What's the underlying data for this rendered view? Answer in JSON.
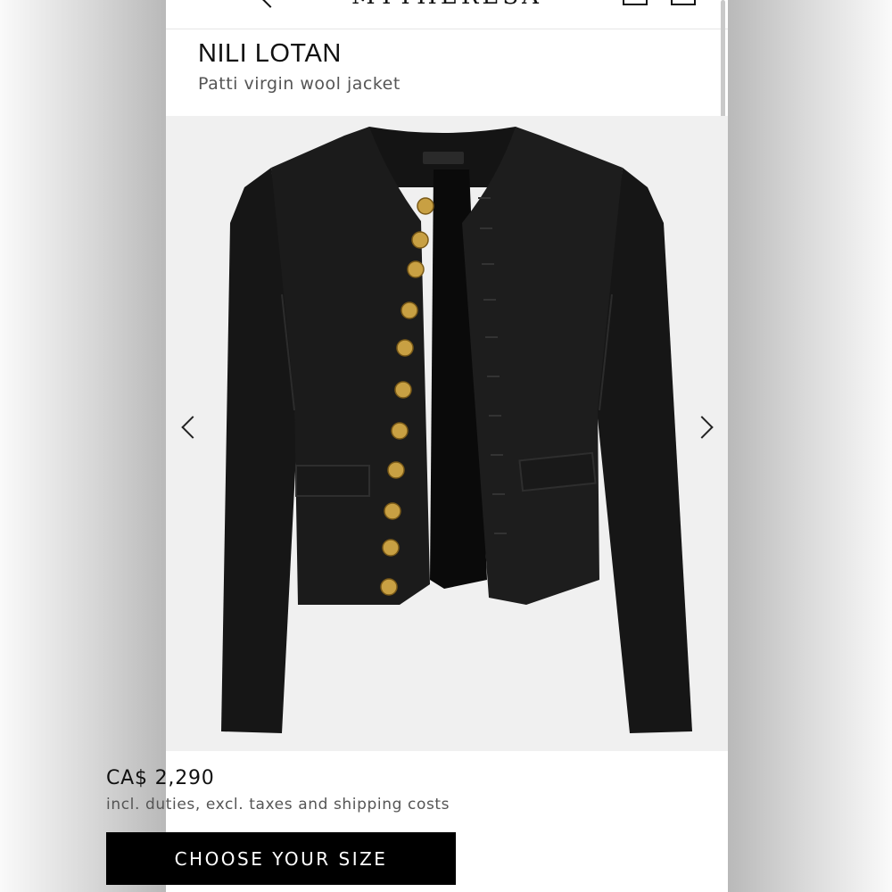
{
  "header": {
    "logo_text": "MYTHERESA",
    "icons": [
      "menu-icon",
      "back-icon",
      "account-icon",
      "bag-icon"
    ]
  },
  "product": {
    "brand": "NILI LOTAN",
    "name": "Patti virgin wool jacket",
    "price": "CA$ 2,290",
    "price_note": "incl. duties, excl. taxes and shipping costs",
    "cta_label": "CHOOSE YOUR SIZE"
  },
  "gallery": {
    "image_subject": "black jacket with gold buttons",
    "arrows": [
      "previous-arrow-icon",
      "next-arrow-icon"
    ]
  },
  "colors": {
    "button_bg": "#000000",
    "button_text": "#ffffff",
    "brand_text": "#111111",
    "secondary_text": "#555555",
    "gallery_bg": "#f0f0f0",
    "button_gold": "#c8a043"
  }
}
